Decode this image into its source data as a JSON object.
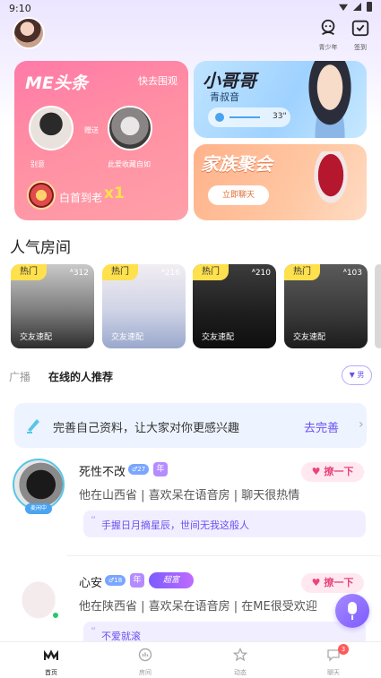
{
  "status_bar": {
    "time": "9:10"
  },
  "header": {
    "teen_label": "青少年",
    "sign_label": "签到"
  },
  "banners": {
    "me": {
      "title": "ME头条",
      "watch": "快去围观",
      "user1_name": "别意",
      "user2_name": "此爱收藏自如",
      "heart_text": "赠送",
      "bottom_text": "白首到老",
      "bottom_count": "x1"
    },
    "xgg": {
      "title": "小哥哥",
      "subtitle": "青叔音",
      "seconds": "33\""
    },
    "family": {
      "title": "家族聚会",
      "button": "立即聊天"
    }
  },
  "popular": {
    "title": "人气房间",
    "rooms": [
      {
        "hot": "热门",
        "count": "312",
        "tag": "交友速配"
      },
      {
        "hot": "热门",
        "count": "216",
        "tag": "交友速配"
      },
      {
        "hot": "热门",
        "count": "210",
        "tag": "交友速配"
      },
      {
        "hot": "热门",
        "count": "103",
        "tag": "交友速配"
      }
    ]
  },
  "tabs": {
    "broadcast": "广播",
    "online": "在线的人推荐",
    "filter": "男"
  },
  "profile_tip": {
    "text": "完善自己资料，让大家对你更感兴趣",
    "link": "去完善"
  },
  "users": [
    {
      "name": "死性不改",
      "level": "27",
      "year_badge": "年",
      "status": "麦闲中",
      "bio": "他在山西省 | 喜欢呆在语音房 | 聊天很热情",
      "chat": "撩一下",
      "quote": "手握日月摘星辰，世间无我这般人"
    },
    {
      "name": "心安",
      "level": "18",
      "year_badge": "年",
      "super_badge": "超富",
      "bio": "他在陕西省 | 喜欢呆在语音房 | 在ME很受欢迎",
      "chat": "撩一下",
      "quote": "不爱就滚"
    }
  ],
  "bottom_nav": {
    "home": "首页",
    "room": "房间",
    "feed": "动态",
    "chat": "聊天",
    "chat_badge": "3"
  },
  "colors": {
    "accent": "#6a4ff0",
    "hot_badge": "#ffe04d",
    "chat_pink": "#e8457c"
  }
}
